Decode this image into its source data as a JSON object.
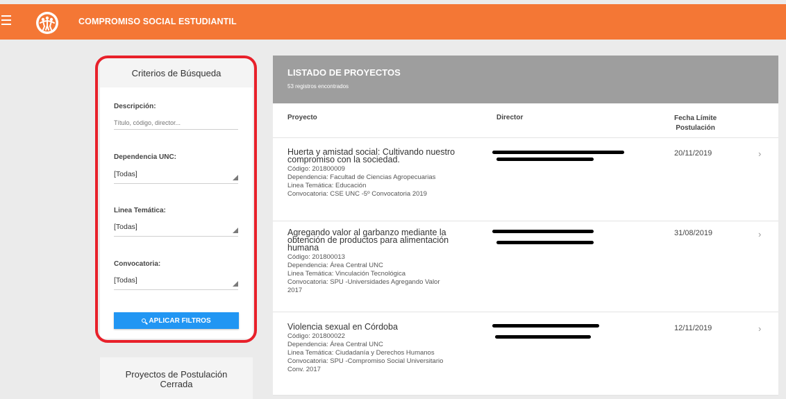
{
  "app": {
    "title": "COMPROMISO SOCIAL ESTUDIANTIL",
    "accent_color": "#f47735",
    "menu_icon": "hamburger-icon",
    "logo_icon": "people-logo"
  },
  "filters": {
    "header": "Criterios de Búsqueda",
    "descripcion": {
      "label": "Descripción:",
      "placeholder": "Título, código, director..."
    },
    "dependencia": {
      "label": "Dependencia UNC:",
      "value": "[Todas]"
    },
    "linea": {
      "label": "Linea Temática:",
      "value": "[Todas]"
    },
    "convocatoria": {
      "label": "Convocatoria:",
      "value": "[Todas]"
    },
    "apply_label": "APLICAR FILTROS",
    "apply_icon": "search-icon",
    "button_color": "#2196f3",
    "highlight_color": "#e8202a"
  },
  "closed": {
    "line1": "Proyectos de Postulación",
    "line2": "Cerrada"
  },
  "list": {
    "title": "LISTADO DE PROYECTOS",
    "count": "53 registros encontrados",
    "columns": {
      "project": "Proyecto",
      "director": "Director",
      "deadline_1": "Fecha Límite",
      "deadline_2": "Postulación"
    },
    "projects": [
      {
        "title_1": "Huerta y amistad social: Cultivando nuestro",
        "title_2": "compromiso con la sociedad.",
        "code": "Código: 201800009",
        "dependencia": "Dependencia: Facultad de Ciencias Agropecuarias",
        "linea": "Linea Temática: Educación",
        "convocatoria": "Convocatoria: CSE UNC -5º Convocatoria 2019",
        "date": "20/11/2019"
      },
      {
        "title_1": "Agregando valor al garbanzo mediante la",
        "title_2": "obtención de productos para alimentación",
        "title_3": "humana",
        "code": "Código: 201800013",
        "dependencia": "Dependencia: Área Central UNC",
        "linea": "Linea Temática: Vinculación Tecnológica",
        "convocatoria_1": "Convocatoria: SPU -Universidades Agregando Valor",
        "convocatoria_2": "2017",
        "date": "31/08/2019"
      },
      {
        "title_1": "Violencia sexual en Córdoba",
        "code": "Código: 201800022",
        "dependencia": "Dependencia: Área Central UNC",
        "linea": "Linea Temática: Ciudadanía y Derechos Humanos",
        "convocatoria_1": "Convocatoria: SPU -Compromiso Social Universitario",
        "convocatoria_2": "Conv. 2017",
        "date": "12/11/2019"
      }
    ],
    "chevron": "chevron-right-icon"
  }
}
